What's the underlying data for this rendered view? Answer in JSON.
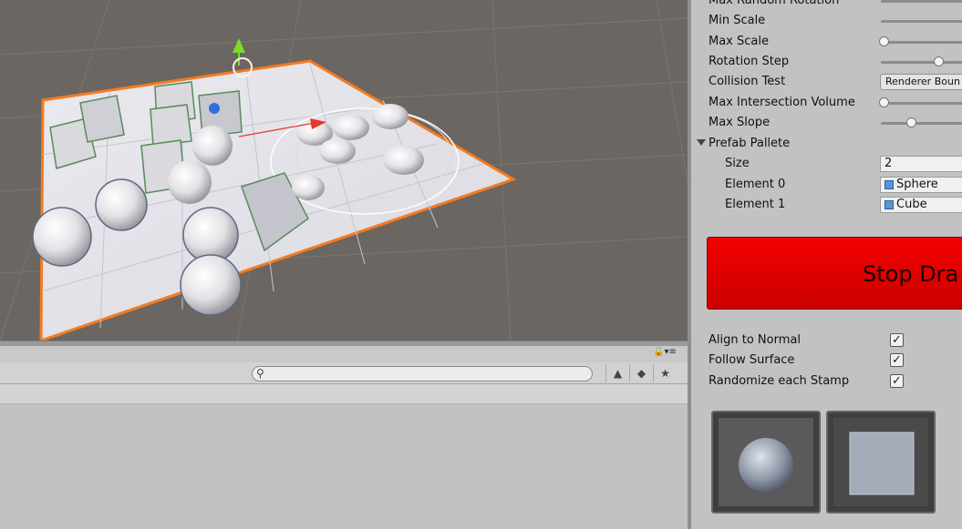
{
  "inspector": {
    "rows": [
      {
        "label": "Max Random Rotation",
        "kind": "slider",
        "thumb": 0.0
      },
      {
        "label": "Min Scale",
        "kind": "slider",
        "thumb": 0.0
      },
      {
        "label": "Max Scale",
        "kind": "slider",
        "thumb": 0.0
      },
      {
        "label": "Rotation Step",
        "kind": "slider",
        "thumb": 0.6
      },
      {
        "label": "Collision Test",
        "kind": "dropdown",
        "value": "Renderer Boun"
      },
      {
        "label": "Max Intersection Volume",
        "kind": "slider",
        "thumb": 0.0
      },
      {
        "label": "Max Slope",
        "kind": "slider",
        "thumb": 0.3
      }
    ],
    "prefab_pallete": {
      "label": "Prefab Pallete",
      "size_label": "Size",
      "size_value": "2",
      "elements": [
        {
          "label": "Element 0",
          "value": "Sphere"
        },
        {
          "label": "Element 1",
          "value": "Cube"
        }
      ]
    },
    "stop_button_label": "Stop Dra",
    "toggles": [
      {
        "label": "Align to Normal",
        "checked": true
      },
      {
        "label": "Follow Surface",
        "checked": true
      },
      {
        "label": "Randomize each Stamp",
        "checked": true
      }
    ],
    "checkmark": "✓",
    "previews": [
      "sphere-preview",
      "cube-preview"
    ]
  },
  "project_panel": {
    "search_placeholder": "",
    "lock_glyph": "🔒▾≡",
    "search_glyph": "⚲",
    "toolbar_glyphs": [
      "▲",
      "◆",
      "★"
    ]
  },
  "colors": {
    "stop_button": "#e00000",
    "selection_outline": "#f47b20",
    "gizmo_y": "#7ddc2a",
    "gizmo_x": "#e23a2a",
    "gizmo_z": "#2f6fe0"
  }
}
